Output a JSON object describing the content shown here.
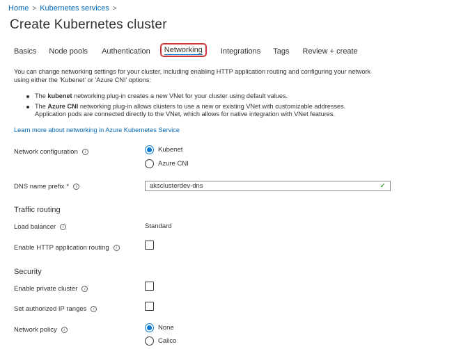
{
  "breadcrumb": [
    {
      "label": "Home"
    },
    {
      "label": "Kubernetes services"
    }
  ],
  "breadcrumb_separator": ">",
  "page_title": "Create Kubernetes cluster",
  "more_label": "...",
  "tabs": [
    {
      "label": "Basics",
      "active": false
    },
    {
      "label": "Node pools",
      "active": false
    },
    {
      "label": "Authentication",
      "active": false
    },
    {
      "label": "Networking",
      "active": true
    },
    {
      "label": "Integrations",
      "active": false
    },
    {
      "label": "Tags",
      "active": false
    },
    {
      "label": "Review + create",
      "active": false
    }
  ],
  "description": "You can change networking settings for your cluster, including enabling HTTP application routing and configuring your network using either the 'Kubenet' or 'Azure CNI' options:",
  "bullets": [
    {
      "prefix": "The ",
      "bold": "kubenet",
      "rest": " networking plug-in creates a new VNet for your cluster using default values."
    },
    {
      "prefix": "The ",
      "bold": "Azure CNI",
      "rest": " networking plug-in allows clusters to use a new or existing VNet with customizable addresses. Application pods are connected directly to the VNet, which allows for native integration with VNet features."
    }
  ],
  "learn_more": "Learn more about networking in Azure Kubernetes Service",
  "network_configuration": {
    "label": "Network configuration",
    "options": [
      "Kubenet",
      "Azure CNI"
    ],
    "selected": "Kubenet"
  },
  "dns_prefix": {
    "label": "DNS name prefix",
    "required_mark": "*",
    "value": "aksclusterdev-dns",
    "valid_mark": "✓"
  },
  "traffic_routing": {
    "heading": "Traffic routing",
    "load_balancer_label": "Load balancer",
    "load_balancer_value": "Standard",
    "http_routing_label": "Enable HTTP application routing",
    "http_routing_checked": false
  },
  "security": {
    "heading": "Security",
    "private_cluster_label": "Enable private cluster",
    "private_cluster_checked": false,
    "authorized_ip_label": "Set authorized IP ranges",
    "authorized_ip_checked": false,
    "network_policy_label": "Network policy",
    "network_policy_options": [
      "None",
      "Calico"
    ],
    "network_policy_selected": "None"
  },
  "info_glyph": "i",
  "colors": {
    "link": "#0067b8",
    "accent": "#0078d4",
    "highlight": "#d13438",
    "valid": "#107c10"
  }
}
